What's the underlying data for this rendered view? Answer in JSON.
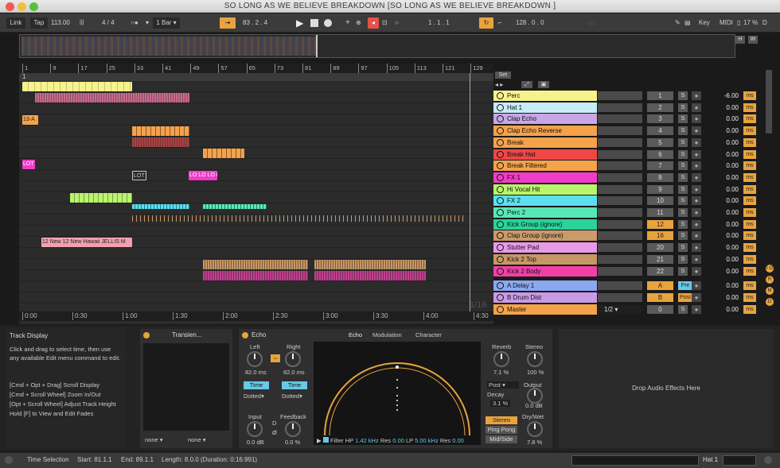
{
  "window": {
    "title": "SO LONG AS WE BELIEVE BREAKDOWN  [SO LONG AS WE BELIEVE BREAKDOWN ]"
  },
  "control_bar": {
    "link": "Link",
    "tap": "Tap",
    "tempo": "113.00",
    "signature": "4 / 4",
    "quantize": "1 Bar",
    "position": "83 .  2 .  4",
    "loop_start": "1 .  1 .  1",
    "loop_length": "128 .  0 .  0",
    "key": "Key",
    "midi": "MIDI",
    "cpu": "17 %",
    "D": "D"
  },
  "view_buttons": {
    "h": "H",
    "w": "W"
  },
  "ruler": {
    "bars": [
      "1",
      "9",
      "17",
      "25",
      "33",
      "41",
      "49",
      "57",
      "65",
      "73",
      "81",
      "89",
      "97",
      "105",
      "113",
      "121",
      "129"
    ]
  },
  "set_label": "Set",
  "loop_marker": "1",
  "arrangement_clips": {
    "c13": "13-A",
    "lot1": "LOT",
    "lot2": "LOT",
    "lo": "LO LO LO LO",
    "hawaii": "12 New 12 New Hawaii JELLIS M"
  },
  "timecodes": [
    "0:00",
    "0:30",
    "1:00",
    "1:30",
    "2:00",
    "2:30",
    "3:00",
    "3:30",
    "4:00",
    "4:30"
  ],
  "grid_label": "1/16",
  "tracks": [
    {
      "name": "Perc",
      "num": "1",
      "vol": "-6.00",
      "color": "#f7f28b"
    },
    {
      "name": "Hat 1",
      "num": "2",
      "vol": "0.00",
      "color": "#c7ecf7"
    },
    {
      "name": "Clap Echo",
      "num": "3",
      "vol": "0.00",
      "color": "#c9a7e6"
    },
    {
      "name": "Clap Echo Reverse",
      "num": "4",
      "vol": "0.00",
      "color": "#f5a24a"
    },
    {
      "name": "Break",
      "num": "5",
      "vol": "0.00",
      "color": "#f5a24a"
    },
    {
      "name": "Break Hat",
      "num": "6",
      "vol": "0.00",
      "color": "#f04646"
    },
    {
      "name": "Break Filtered",
      "num": "7",
      "vol": "0.00",
      "color": "#f5a24a"
    },
    {
      "name": "FX 1",
      "num": "8",
      "vol": "0.00",
      "color": "#f03cc8"
    },
    {
      "name": "Hi Vocal Hit",
      "num": "9",
      "vol": "0.00",
      "color": "#b9f56a"
    },
    {
      "name": "FX 2",
      "num": "10",
      "vol": "0.00",
      "color": "#5ae0f0"
    },
    {
      "name": "Perc 2",
      "num": "11",
      "vol": "0.00",
      "color": "#58e8b8"
    },
    {
      "name": "Kick Group (ignore)",
      "num": "12",
      "vol": "0.00",
      "color": "#2ad39a"
    },
    {
      "name": "Clap Group (ignore)",
      "num": "16",
      "vol": "0.00",
      "color": "#c99a6a"
    },
    {
      "name": "Stutter Pad",
      "num": "20",
      "vol": "0.00",
      "color": "#e899e8"
    },
    {
      "name": "Kick 2 Top",
      "num": "21",
      "vol": "0.00",
      "color": "#c69866"
    },
    {
      "name": "Kick 2 Body",
      "num": "22",
      "vol": "0.00",
      "color": "#f040a8"
    },
    {
      "name": "A Delay 1",
      "num": "A",
      "vol": "0.00",
      "color": "#8aa7f0",
      "send": "Pre"
    },
    {
      "name": "B Drum Dist",
      "num": "B",
      "vol": "0.00",
      "color": "#c99ae6",
      "send": "Post"
    },
    {
      "name": "Master",
      "num": "0",
      "vol": "0.00",
      "color": "#f5a24a",
      "io": "1/2"
    }
  ],
  "side_buttons": [
    "I O",
    "R",
    "M",
    "D"
  ],
  "info": {
    "title": "Track Display",
    "text1": "Click and drag to select time, then use any available Edit menu command to edit.",
    "text2": "[Cmd + Opt + Drag] Scroll Display",
    "text3": "[Cmd + Scroll Wheel] Zoom In/Out",
    "text4": "[Opt + Scroll Wheel] Adjust Track Height",
    "text5": "Hold [F] to View and Edit Fades"
  },
  "transient": {
    "title": "Transien...",
    "sel1": "none",
    "sel2": "none"
  },
  "echo": {
    "title": "Echo",
    "tabs": [
      "Echo",
      "Modulation",
      "Character"
    ],
    "left_label": "Left",
    "left_val": "82.0 ms",
    "right_label": "Right",
    "right_val": "82.0 ms",
    "time_l": "Time",
    "time_r": "Time",
    "dotted_l": "Dotted",
    "dotted_r": "Dotted",
    "input_label": "Input",
    "input_val": "0.0 dB",
    "feedback_label": "Feedback",
    "feedback_val": "0.0 %",
    "d_btn": "D",
    "filter_label": "Filter",
    "hp_label": "HP",
    "hp_val": "1.42 kHz",
    "res1_label": "Res",
    "res1_val": "0.00",
    "lp_label": "LP",
    "lp_val": "5.00 kHz",
    "res2_label": "Res",
    "res2_val": "0.00",
    "reverb_label": "Reverb",
    "reverb_val": "7.1 %",
    "stereo_label": "Stereo",
    "stereo_val": "100 %",
    "post": "Post",
    "decay_label": "Decay",
    "decay_val": "3.1 %",
    "output_label": "Output",
    "output_val": "0.0 dB",
    "mode_stereo": "Stereo",
    "mode_pp": "Ping Pong",
    "mode_ms": "Mid/Side",
    "drywet_label": "Dry/Wet",
    "drywet_val": "7.8 %"
  },
  "drop_zone": "Drop Audio Effects Here",
  "status": {
    "selection": "Time Selection",
    "start": "Start: 81.1.1",
    "end": "End: 89.1.1",
    "length": "Length: 8.0.0  (Duration: 0:16:991)",
    "track": "Hat 1"
  },
  "colors": {
    "accent": "#e8a33d",
    "blue": "#67c8e8"
  }
}
